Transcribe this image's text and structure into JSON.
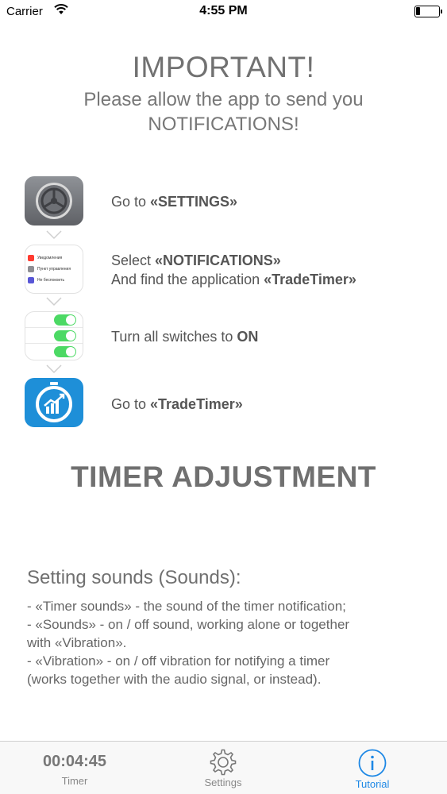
{
  "status_bar": {
    "carrier": "Carrier",
    "time": "4:55 PM"
  },
  "header": {
    "title": "IMPORTANT!",
    "subtitle_line1": "Please allow the app to send you",
    "subtitle_line2": "NOTIFICATIONS!"
  },
  "steps": [
    {
      "icon": "settings-gear-icon",
      "prefix": "Go to ",
      "bold": "«SETTINGS»"
    },
    {
      "icon": "notifications-list-icon",
      "prefix": "Select ",
      "bold": "«NOTIFICATIONS»",
      "line2_prefix": "And find the application ",
      "line2_bold": "«TradeTimer»",
      "thumb_rows": [
        "Уведомления",
        "Пункт управления",
        "Не беспокоить"
      ]
    },
    {
      "icon": "switches-icon",
      "prefix": "Turn all switches to ",
      "bold": "ON"
    },
    {
      "icon": "tradetimer-app-icon",
      "prefix": "Go to ",
      "bold": "«TradeTimer»"
    }
  ],
  "timer_section": {
    "title": "TIMER ADJUSTMENT",
    "sounds_heading": "Setting sounds (Sounds):",
    "lines": [
      "- «Timer sounds» - the sound of the timer notification;",
      "- «Sounds» - on / off sound, working alone or together",
      "with «Vibration».",
      "- «Vibration» - on / off vibration for notifying a timer",
      "(works together with the audio signal, or instead)."
    ]
  },
  "tab_bar": {
    "timer_value": "00:04:45",
    "timer_label": "Timer",
    "settings_label": "Settings",
    "tutorial_label": "Tutorial",
    "active_color": "#1e88e5"
  },
  "colors": {
    "app_icon_blue": "#1e8fd8",
    "switch_green": "#4cd964"
  }
}
